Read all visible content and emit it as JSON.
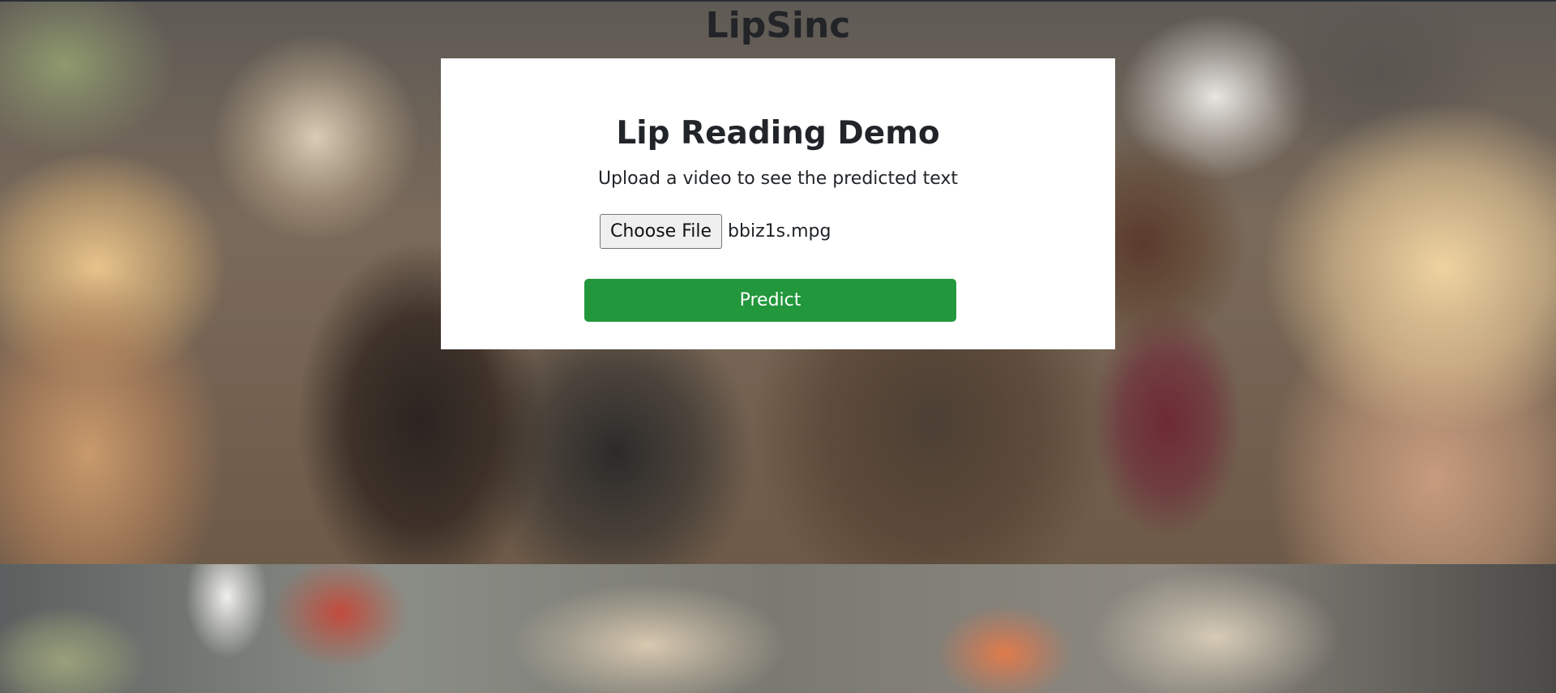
{
  "site": {
    "title": "LipSinc"
  },
  "card": {
    "title": "Lip Reading Demo",
    "subtitle": "Upload a video to see the predicted text",
    "file_input": {
      "button_label": "Choose File",
      "file_name": "bbiz1s.mpg"
    },
    "predict_label": "Predict"
  },
  "colors": {
    "predict_button": "#22973c",
    "card_background": "#ffffff",
    "text": "#212529"
  }
}
